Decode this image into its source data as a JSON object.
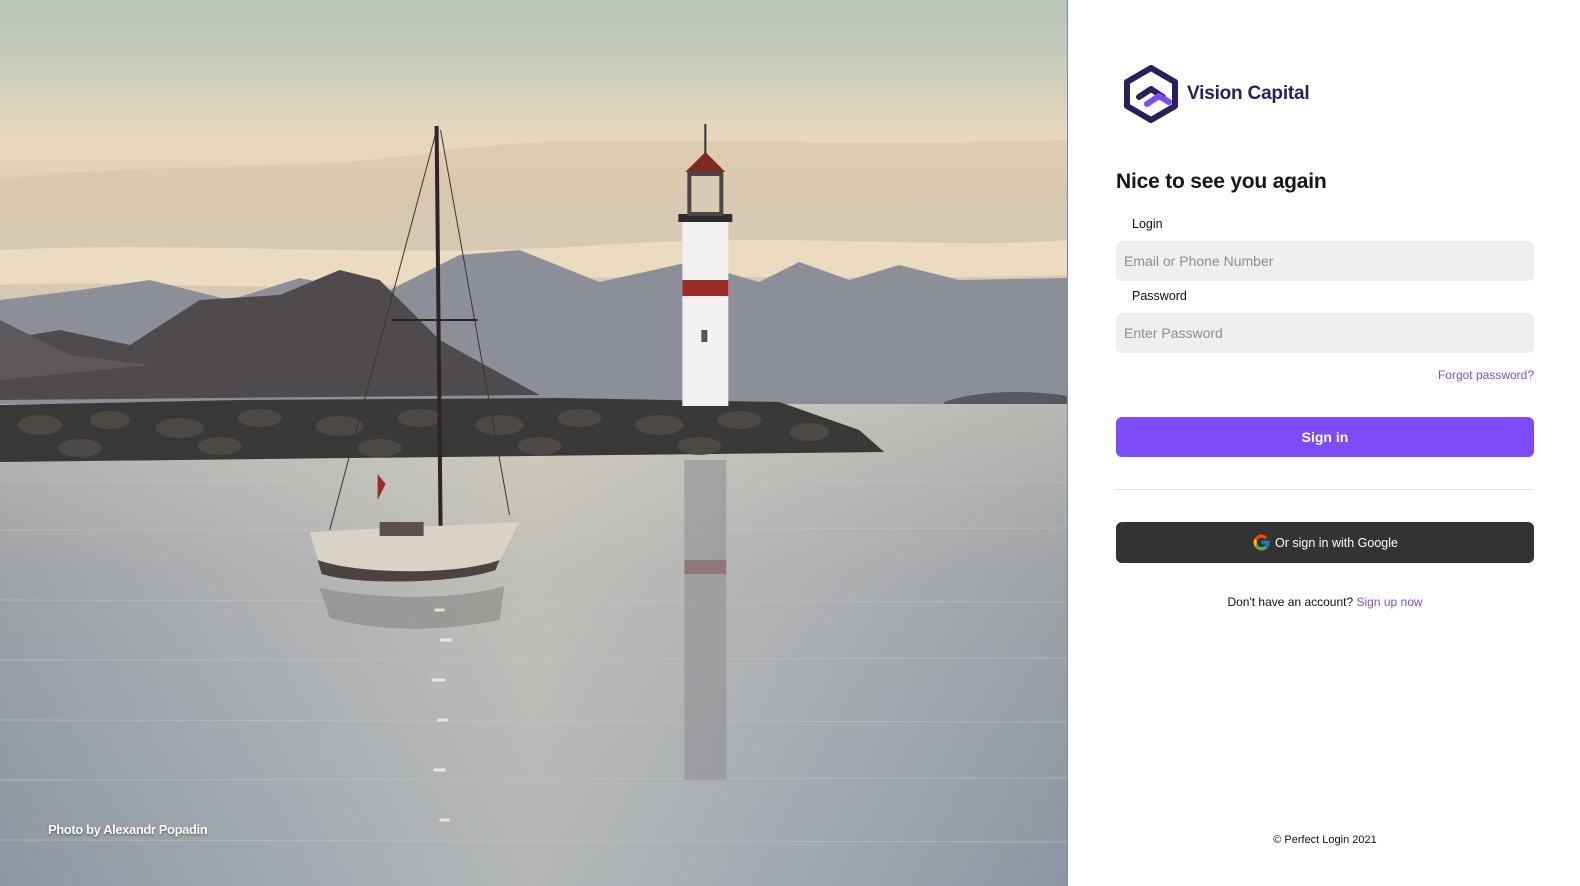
{
  "photo": {
    "credit": "Photo by Alexandr Popadin"
  },
  "brand": {
    "name": "Vision Capital",
    "logo_icon": "hexagon-logo-icon",
    "color": "#2a1f5c",
    "accent": "#7d4cf8"
  },
  "form": {
    "heading": "Nice to see you again",
    "login_label": "Login",
    "login_placeholder": "Email or Phone Number",
    "password_label": "Password",
    "password_placeholder": "Enter Password",
    "forgot_label": "Forgot password?",
    "signin_label": "Sign in",
    "google_label": "Or sign in with Google",
    "google_icon": "google-icon",
    "signup_prompt": "Don't have an account?",
    "signup_link": "Sign up now"
  },
  "footer": {
    "copyright": "© Perfect Login 2021"
  }
}
